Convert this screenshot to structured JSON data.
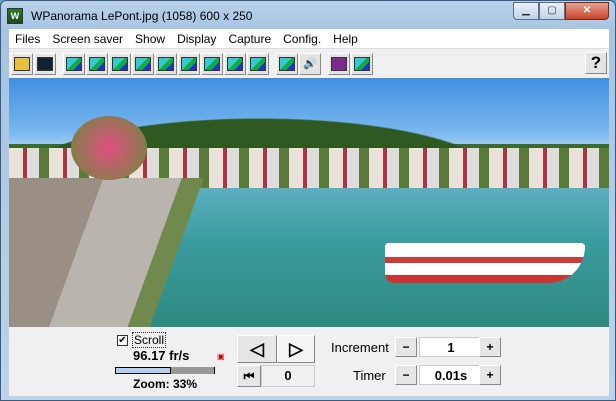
{
  "window": {
    "title": "WPanorama  LePont.jpg    (1058) 600 x 250",
    "app_icon_letter": "W"
  },
  "menu": [
    "Files",
    "Screen saver",
    "Show",
    "Display",
    "Capture",
    "Config.",
    "Help"
  ],
  "toolbar": {
    "help_label": "?"
  },
  "controls": {
    "scroll_label": "Scroll",
    "scroll_checked": true,
    "check_mark": "✔",
    "fps": "96.17 fr/s",
    "zoom_label": "Zoom: 33%",
    "zoom_fraction": 0.57,
    "prev_icon": "◁",
    "next_icon": "▷",
    "first_icon": "⏮",
    "position": "0",
    "increment_label": "Increment",
    "increment_value": "1",
    "timer_label": "Timer",
    "timer_value": "0.01s",
    "minus": "−",
    "plus": "+"
  }
}
